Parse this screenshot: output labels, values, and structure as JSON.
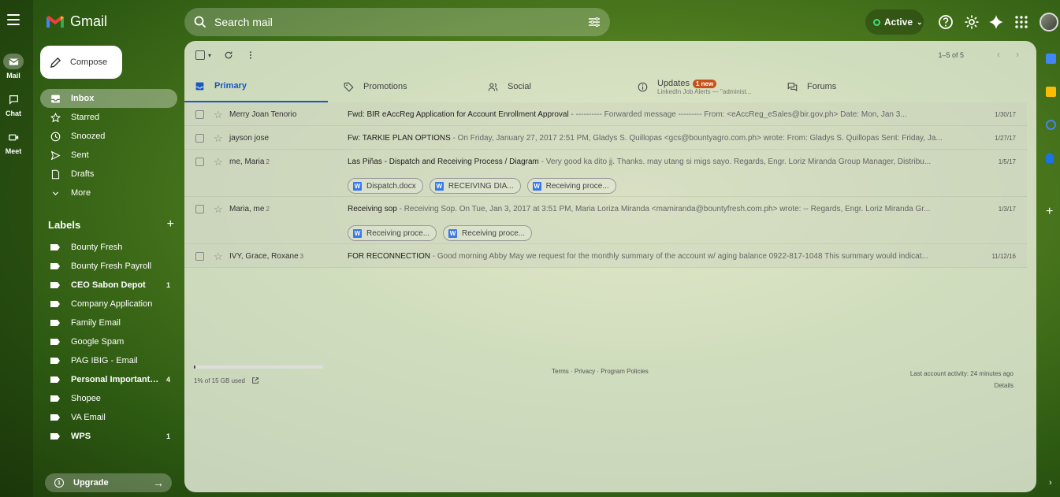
{
  "brand": {
    "name": "Gmail"
  },
  "rail": [
    {
      "label": "Mail",
      "icon": "mail-icon"
    },
    {
      "label": "Chat",
      "icon": "chat-icon"
    },
    {
      "label": "Meet",
      "icon": "meet-icon"
    }
  ],
  "search": {
    "placeholder": "Search mail"
  },
  "status": {
    "label": "Active"
  },
  "compose": {
    "label": "Compose"
  },
  "nav": [
    {
      "label": "Inbox",
      "icon": "inbox-icon"
    },
    {
      "label": "Starred",
      "icon": "star-icon"
    },
    {
      "label": "Snoozed",
      "icon": "clock-icon"
    },
    {
      "label": "Sent",
      "icon": "send-icon"
    },
    {
      "label": "Drafts",
      "icon": "draft-icon"
    },
    {
      "label": "More",
      "icon": "chevron-down-icon"
    }
  ],
  "labels": {
    "title": "Labels",
    "items": [
      {
        "name": "Bounty Fresh",
        "count": ""
      },
      {
        "name": "Bounty Fresh Payroll",
        "count": ""
      },
      {
        "name": "CEO Sabon Depot",
        "count": "1"
      },
      {
        "name": "Company Application",
        "count": ""
      },
      {
        "name": "Family Email",
        "count": ""
      },
      {
        "name": "Google Spam",
        "count": ""
      },
      {
        "name": "PAG IBIG - Email",
        "count": ""
      },
      {
        "name": "Personal Important ...",
        "count": "4"
      },
      {
        "name": "Shopee",
        "count": ""
      },
      {
        "name": "VA Email",
        "count": ""
      },
      {
        "name": "WPS",
        "count": "1"
      }
    ]
  },
  "upgrade": {
    "label": "Upgrade"
  },
  "toolbar": {
    "pager": "1–5 of 5"
  },
  "tabs": [
    {
      "label": "Primary",
      "icon": "inbox-tab-icon"
    },
    {
      "label": "Promotions",
      "icon": "tag-icon"
    },
    {
      "label": "Social",
      "icon": "people-icon"
    },
    {
      "label": "Updates",
      "icon": "info-icon",
      "badge": "1 new",
      "sub": "LinkedIn Job Alerts — \"administ..."
    },
    {
      "label": "Forums",
      "icon": "forum-icon"
    }
  ],
  "emails": [
    {
      "sender": "Merry Joan Tenorio",
      "count": "",
      "subject": "Fwd: BIR eAccReg Application for Account Enrollment Approval",
      "snippet": " - ---------- Forwarded message --------- From: <eAccReg_eSales@bir.gov.ph> Date: Mon, Jan 3...",
      "date": "1/30/17",
      "attachments": []
    },
    {
      "sender": "jayson jose",
      "count": "",
      "subject": "Fw: TARKIE PLAN OPTIONS",
      "snippet": " - On Friday, January 27, 2017 2:51 PM, Gladys S. Quillopas <gcs@bountyagro.com.ph> wrote: From: Gladys S. Quillopas Sent: Friday, Ja...",
      "date": "1/27/17",
      "attachments": []
    },
    {
      "sender": "me, Maria",
      "count": "2",
      "subject": "Las Piñas - Dispatch and Receiving Process / Diagram",
      "snippet": " - Very good ka dito jj. Thanks. may utang si migs sayo. Regards, Engr. Loriz Miranda Group Manager, Distribu...",
      "date": "1/5/17",
      "attachments": [
        "Dispatch.docx",
        "RECEIVING DIA...",
        "Receiving proce..."
      ]
    },
    {
      "sender": "Maria, me",
      "count": "2",
      "subject": "Receiving sop",
      "snippet": " - Receiving Sop. On Tue, Jan 3, 2017 at 3:51 PM, Maria Loriza Miranda <mamiranda@bountyfresh.com.ph> wrote: -- Regards, Engr. Loriz Miranda Gr...",
      "date": "1/3/17",
      "attachments": [
        "Receiving proce...",
        "Receiving proce..."
      ]
    },
    {
      "sender": "IVY, Grace, Roxane",
      "count": "3",
      "subject": "FOR RECONNECTION",
      "snippet": " - Good morning Abby May we request for the monthly summary of the account w/ aging balance 0922-817-1048 This summary would indicat...",
      "date": "11/12/16",
      "attachments": []
    }
  ],
  "footer": {
    "storage": "1% of 15 GB used",
    "storage_fraction": 0.01,
    "links": "Terms · Privacy · Program Policies",
    "activity": "Last account activity: 24 minutes ago",
    "details": "Details"
  }
}
